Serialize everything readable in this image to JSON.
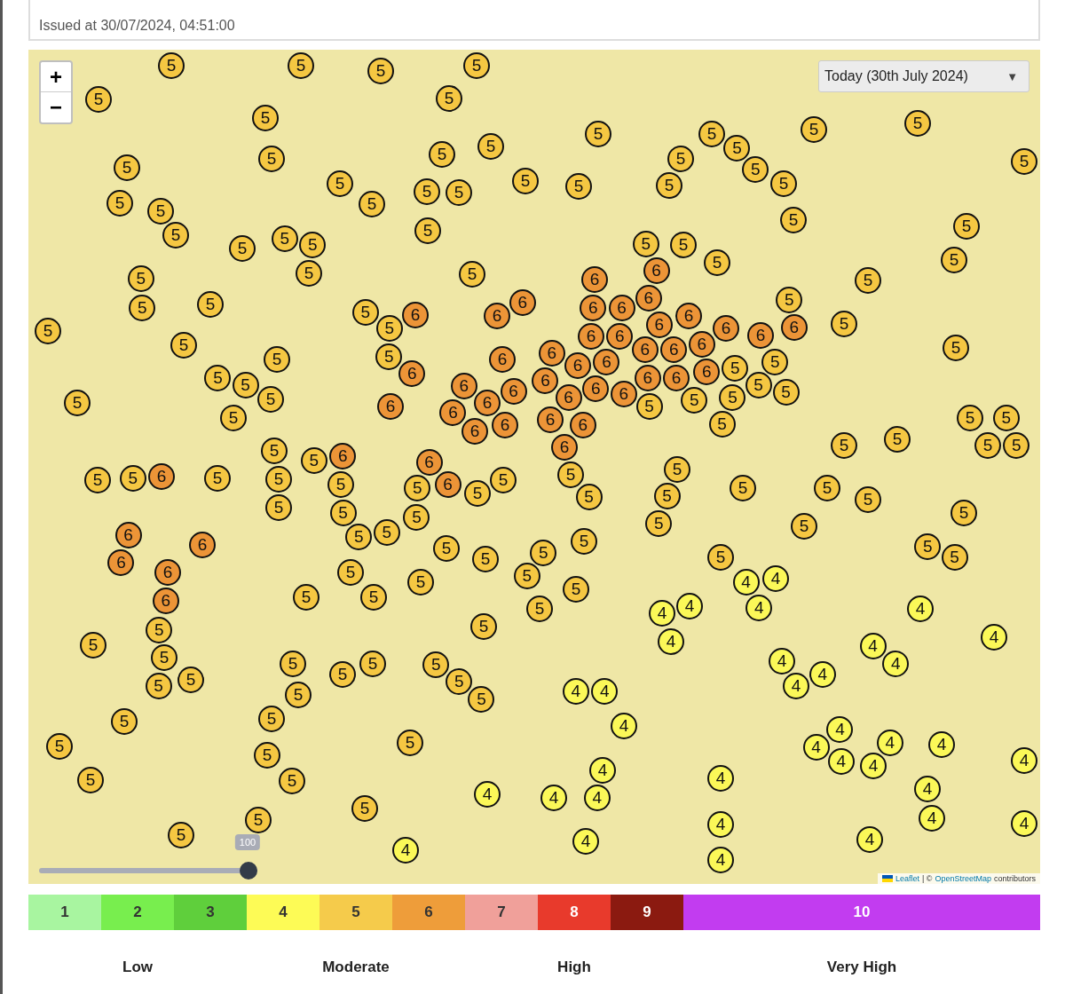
{
  "header": {
    "issued": "Issued at 30/07/2024, 04:51:00"
  },
  "map": {
    "zoom_in": "+",
    "zoom_out": "−",
    "day_select": {
      "value": "Today (30th July 2024)",
      "caret": "▼"
    },
    "slider": {
      "level": 1,
      "reading": "100"
    },
    "attribution": {
      "leaflet": "Leaflet",
      "separator": "| ©",
      "osm": "OpenStreetMap",
      "suffix": "contributors"
    },
    "markers": [
      {
        "label": "5",
        "color": "#f5c742"
      },
      {
        "label": "5",
        "color": "#f5c742"
      },
      {
        "label": "5",
        "color": "#f5c742"
      },
      {
        "label": "5",
        "color": "#f5c742"
      },
      {
        "label": "5",
        "color": "#f5c742"
      },
      {
        "label": "5",
        "color": "#f5c742"
      },
      {
        "label": "5",
        "color": "#f5c742"
      },
      {
        "label": "5",
        "color": "#f5c742"
      },
      {
        "label": "5",
        "color": "#f5c742"
      },
      {
        "label": "5",
        "color": "#f5c742"
      },
      {
        "label": "5",
        "color": "#f5c742"
      },
      {
        "label": "5",
        "color": "#f5c742"
      },
      {
        "label": "5",
        "color": "#f5c742"
      },
      {
        "label": "5",
        "color": "#f5c742"
      },
      {
        "label": "5",
        "color": "#f5c742"
      },
      {
        "label": "5",
        "color": "#f5c742"
      },
      {
        "label": "5",
        "color": "#f5c742"
      },
      {
        "label": "5",
        "color": "#f5c742"
      },
      {
        "label": "5",
        "color": "#f5c742"
      },
      {
        "label": "5",
        "color": "#f5c742"
      },
      {
        "label": "5",
        "color": "#f5c742"
      },
      {
        "label": "5",
        "color": "#f5c742"
      },
      {
        "label": "5",
        "color": "#f5c742"
      },
      {
        "label": "5",
        "color": "#f5c742"
      },
      {
        "label": "5",
        "color": "#f5c742"
      },
      {
        "label": "5",
        "color": "#f5c742"
      },
      {
        "label": "5",
        "color": "#f5c742"
      },
      {
        "label": "5",
        "color": "#f5c742"
      },
      {
        "label": "5",
        "color": "#f5c742"
      },
      {
        "label": "5",
        "color": "#f5c742"
      },
      {
        "label": "5",
        "color": "#f5c742"
      },
      {
        "label": "5",
        "color": "#f5c742"
      },
      {
        "label": "5",
        "color": "#f5c742"
      },
      {
        "label": "5",
        "color": "#f5c742"
      },
      {
        "label": "5",
        "color": "#f5c742"
      },
      {
        "label": "5",
        "color": "#f5c742"
      },
      {
        "label": "5",
        "color": "#f5c742"
      },
      {
        "label": "5",
        "color": "#f5c742"
      },
      {
        "label": "5",
        "color": "#f5c742"
      },
      {
        "label": "5",
        "color": "#f5c742"
      },
      {
        "label": "5",
        "color": "#f5c742"
      },
      {
        "label": "5",
        "color": "#f5c742"
      },
      {
        "label": "5",
        "color": "#f5c742"
      },
      {
        "label": "5",
        "color": "#f5c742"
      },
      {
        "label": "5",
        "color": "#f5c742"
      },
      {
        "label": "5",
        "color": "#f5c742"
      },
      {
        "label": "5",
        "color": "#f5c742"
      },
      {
        "label": "5",
        "color": "#f5c742"
      },
      {
        "label": "5",
        "color": "#f5c742"
      },
      {
        "label": "5",
        "color": "#f5c742"
      },
      {
        "label": "5",
        "color": "#f5c742"
      },
      {
        "label": "5",
        "color": "#f5c742"
      },
      {
        "label": "5",
        "color": "#f5c742"
      },
      {
        "label": "5",
        "color": "#f5c742"
      },
      {
        "label": "5",
        "color": "#f5c742"
      },
      {
        "label": "5",
        "color": "#f5c742"
      },
      {
        "label": "5",
        "color": "#f5c742"
      },
      {
        "label": "5",
        "color": "#f5c742"
      },
      {
        "label": "5",
        "color": "#f5c742"
      },
      {
        "label": "5",
        "color": "#f5c742"
      },
      {
        "label": "5",
        "color": "#f5c742"
      },
      {
        "label": "5",
        "color": "#f5c742"
      },
      {
        "label": "5",
        "color": "#f5c742"
      },
      {
        "label": "5",
        "color": "#f5c742"
      },
      {
        "label": "5",
        "color": "#f5c742"
      },
      {
        "label": "5",
        "color": "#f5c742"
      },
      {
        "label": "5",
        "color": "#f5c742"
      },
      {
        "label": "5",
        "color": "#f5c742"
      },
      {
        "label": "5",
        "color": "#f5c742"
      },
      {
        "label": "5",
        "color": "#f5c742"
      },
      {
        "label": "5",
        "color": "#f5c742"
      },
      {
        "label": "5",
        "color": "#f5c742"
      },
      {
        "label": "5",
        "color": "#f5c742"
      },
      {
        "label": "5",
        "color": "#f5c742"
      },
      {
        "label": "5",
        "color": "#f5c742"
      },
      {
        "label": "5",
        "color": "#f5c742"
      },
      {
        "label": "5",
        "color": "#f5c742"
      },
      {
        "label": "5",
        "color": "#f5c742"
      },
      {
        "label": "5",
        "color": "#f5c742"
      },
      {
        "label": "5",
        "color": "#f5c742"
      },
      {
        "label": "5",
        "color": "#f5c742"
      },
      {
        "label": "5",
        "color": "#f5c742"
      },
      {
        "label": "5",
        "color": "#f5c742"
      },
      {
        "label": "5",
        "color": "#f5c742"
      },
      {
        "label": "5",
        "color": "#f5c742"
      },
      {
        "label": "5",
        "color": "#f5c742"
      },
      {
        "label": "5",
        "color": "#f5c742"
      },
      {
        "label": "5",
        "color": "#f5c742"
      },
      {
        "label": "5",
        "color": "#f5c742"
      },
      {
        "label": "5",
        "color": "#f5c742"
      },
      {
        "label": "5",
        "color": "#f5c742"
      },
      {
        "label": "5",
        "color": "#f5c742"
      },
      {
        "label": "5",
        "color": "#f5c742"
      },
      {
        "label": "5",
        "color": "#f5c742"
      },
      {
        "label": "5",
        "color": "#f5c742"
      },
      {
        "label": "5",
        "color": "#f5c742"
      },
      {
        "label": "5",
        "color": "#f5c742"
      },
      {
        "label": "5",
        "color": "#f5c742"
      },
      {
        "label": "5",
        "color": "#f5c742"
      },
      {
        "label": "5",
        "color": "#f5c742"
      },
      {
        "label": "5",
        "color": "#f5c742"
      },
      {
        "label": "5",
        "color": "#f5c742"
      },
      {
        "label": "5",
        "color": "#f5c742"
      },
      {
        "label": "5",
        "color": "#f5c742"
      },
      {
        "label": "5",
        "color": "#f5c742"
      },
      {
        "label": "5",
        "color": "#f5c742"
      },
      {
        "label": "5",
        "color": "#f5c742"
      },
      {
        "label": "5",
        "color": "#f5c742"
      },
      {
        "label": "5",
        "color": "#f5c742"
      },
      {
        "label": "5",
        "color": "#f5c742"
      },
      {
        "label": "5",
        "color": "#f5c742"
      },
      {
        "label": "5",
        "color": "#f5c742"
      },
      {
        "label": "5",
        "color": "#f5c742"
      },
      {
        "label": "5",
        "color": "#f5c742"
      },
      {
        "label": "5",
        "color": "#f5c742"
      },
      {
        "label": "5",
        "color": "#f5c742"
      },
      {
        "label": "5",
        "color": "#f5c742"
      },
      {
        "label": "5",
        "color": "#f5c742"
      },
      {
        "label": "5",
        "color": "#f5c742"
      },
      {
        "label": "5",
        "color": "#f5c742"
      },
      {
        "label": "5",
        "color": "#f5c742"
      },
      {
        "label": "5",
        "color": "#f5c742"
      },
      {
        "label": "5",
        "color": "#f5c742"
      },
      {
        "label": "5",
        "color": "#f5c742"
      },
      {
        "label": "5",
        "color": "#f5c742"
      },
      {
        "label": "5",
        "color": "#f5c742"
      },
      {
        "label": "5",
        "color": "#f5c742"
      },
      {
        "label": "5",
        "color": "#f5c742"
      },
      {
        "label": "5",
        "color": "#f5c742"
      },
      {
        "label": "5",
        "color": "#f5c742"
      },
      {
        "label": "5",
        "color": "#f5c742"
      },
      {
        "label": "5",
        "color": "#f5c742"
      },
      {
        "label": "5",
        "color": "#f5c742"
      },
      {
        "label": "5",
        "color": "#f5c742"
      },
      {
        "label": "5",
        "color": "#f5c742"
      },
      {
        "label": "5",
        "color": "#f5c742"
      },
      {
        "label": "6",
        "color": "#ec9437"
      },
      {
        "label": "6",
        "color": "#ec9437"
      },
      {
        "label": "6",
        "color": "#ec9437"
      },
      {
        "label": "6",
        "color": "#ec9437"
      },
      {
        "label": "6",
        "color": "#ec9437"
      },
      {
        "label": "6",
        "color": "#ec9437"
      },
      {
        "label": "6",
        "color": "#ec9437"
      },
      {
        "label": "6",
        "color": "#ec9437"
      },
      {
        "label": "6",
        "color": "#ec9437"
      },
      {
        "label": "6",
        "color": "#ec9437"
      },
      {
        "label": "6",
        "color": "#ec9437"
      },
      {
        "label": "6",
        "color": "#ec9437"
      },
      {
        "label": "6",
        "color": "#ec9437"
      },
      {
        "label": "6",
        "color": "#ec9437"
      },
      {
        "label": "6",
        "color": "#ec9437"
      },
      {
        "label": "6",
        "color": "#ec9437"
      },
      {
        "label": "6",
        "color": "#ec9437"
      },
      {
        "label": "6",
        "color": "#ec9437"
      },
      {
        "label": "6",
        "color": "#ec9437"
      },
      {
        "label": "6",
        "color": "#ec9437"
      },
      {
        "label": "6",
        "color": "#ec9437"
      },
      {
        "label": "6",
        "color": "#ec9437"
      },
      {
        "label": "6",
        "color": "#ec9437"
      },
      {
        "label": "6",
        "color": "#ec9437"
      },
      {
        "label": "6",
        "color": "#ec9437"
      },
      {
        "label": "6",
        "color": "#ec9437"
      },
      {
        "label": "6",
        "color": "#ec9437"
      },
      {
        "label": "6",
        "color": "#ec9437"
      },
      {
        "label": "6",
        "color": "#ec9437"
      },
      {
        "label": "6",
        "color": "#ec9437"
      },
      {
        "label": "6",
        "color": "#ec9437"
      },
      {
        "label": "6",
        "color": "#ec9437"
      },
      {
        "label": "6",
        "color": "#ec9437"
      },
      {
        "label": "6",
        "color": "#ec9437"
      },
      {
        "label": "6",
        "color": "#ec9437"
      },
      {
        "label": "6",
        "color": "#ec9437"
      },
      {
        "label": "6",
        "color": "#ec9437"
      },
      {
        "label": "6",
        "color": "#ec9437"
      },
      {
        "label": "6",
        "color": "#ec9437"
      },
      {
        "label": "6",
        "color": "#ec9437"
      },
      {
        "label": "6",
        "color": "#ec9437"
      },
      {
        "label": "6",
        "color": "#ec9437"
      },
      {
        "label": "6",
        "color": "#ec9437"
      },
      {
        "label": "6",
        "color": "#ec9437"
      },
      {
        "label": "6",
        "color": "#ec9437"
      },
      {
        "label": "6",
        "color": "#ec9437"
      },
      {
        "label": "6",
        "color": "#ec9437"
      },
      {
        "label": "6",
        "color": "#ec9437"
      },
      {
        "label": "6",
        "color": "#ec9437"
      },
      {
        "label": "4",
        "color": "#fbf858"
      },
      {
        "label": "4",
        "color": "#fbf858"
      },
      {
        "label": "4",
        "color": "#fbf858"
      },
      {
        "label": "4",
        "color": "#fbf858"
      },
      {
        "label": "4",
        "color": "#fbf858"
      },
      {
        "label": "4",
        "color": "#fbf858"
      },
      {
        "label": "4",
        "color": "#fbf858"
      },
      {
        "label": "4",
        "color": "#fbf858"
      },
      {
        "label": "4",
        "color": "#fbf858"
      },
      {
        "label": "4",
        "color": "#fbf858"
      },
      {
        "label": "4",
        "color": "#fbf858"
      },
      {
        "label": "4",
        "color": "#fbf858"
      },
      {
        "label": "4",
        "color": "#fbf858"
      },
      {
        "label": "4",
        "color": "#fbf858"
      },
      {
        "label": "4",
        "color": "#fbf858"
      },
      {
        "label": "4",
        "color": "#fbf858"
      },
      {
        "label": "4",
        "color": "#fbf858"
      },
      {
        "label": "4",
        "color": "#fbf858"
      },
      {
        "label": "4",
        "color": "#fbf858"
      },
      {
        "label": "4",
        "color": "#fbf858"
      },
      {
        "label": "4",
        "color": "#fbf858"
      },
      {
        "label": "4",
        "color": "#fbf858"
      },
      {
        "label": "4",
        "color": "#fbf858"
      },
      {
        "label": "4",
        "color": "#fbf858"
      },
      {
        "label": "4",
        "color": "#fbf858"
      },
      {
        "label": "4",
        "color": "#fbf858"
      },
      {
        "label": "4",
        "color": "#fbf858"
      },
      {
        "label": "4",
        "color": "#fbf858"
      },
      {
        "label": "4",
        "color": "#fbf858"
      },
      {
        "label": "4",
        "color": "#fbf858"
      },
      {
        "label": "4",
        "color": "#fbf858"
      },
      {
        "label": "4",
        "color": "#fbf858"
      },
      {
        "label": "4",
        "color": "#fbf858"
      },
      {
        "label": "4",
        "color": "#fbf858"
      },
      {
        "label": "4",
        "color": "#fbf858"
      },
      {
        "label": "4",
        "color": "#fbf858"
      }
    ]
  },
  "legend": {
    "levels": [
      {
        "label": "1",
        "color": "#a8f5a0"
      },
      {
        "label": "2",
        "color": "#78ee4e"
      },
      {
        "label": "3",
        "color": "#5fcf3c"
      },
      {
        "label": "4",
        "color": "#fdfb56"
      },
      {
        "label": "5",
        "color": "#f5cb4b"
      },
      {
        "label": "6",
        "color": "#ee9d3a"
      },
      {
        "label": "7",
        "color": "#f0a09a"
      },
      {
        "label": "8",
        "color": "#e83a2c"
      },
      {
        "label": "9",
        "color": "#8b1a10"
      },
      {
        "label": "10",
        "color": "#c23cf0"
      }
    ],
    "bands": [
      "Low",
      "Moderate",
      "High",
      "Very High"
    ]
  }
}
